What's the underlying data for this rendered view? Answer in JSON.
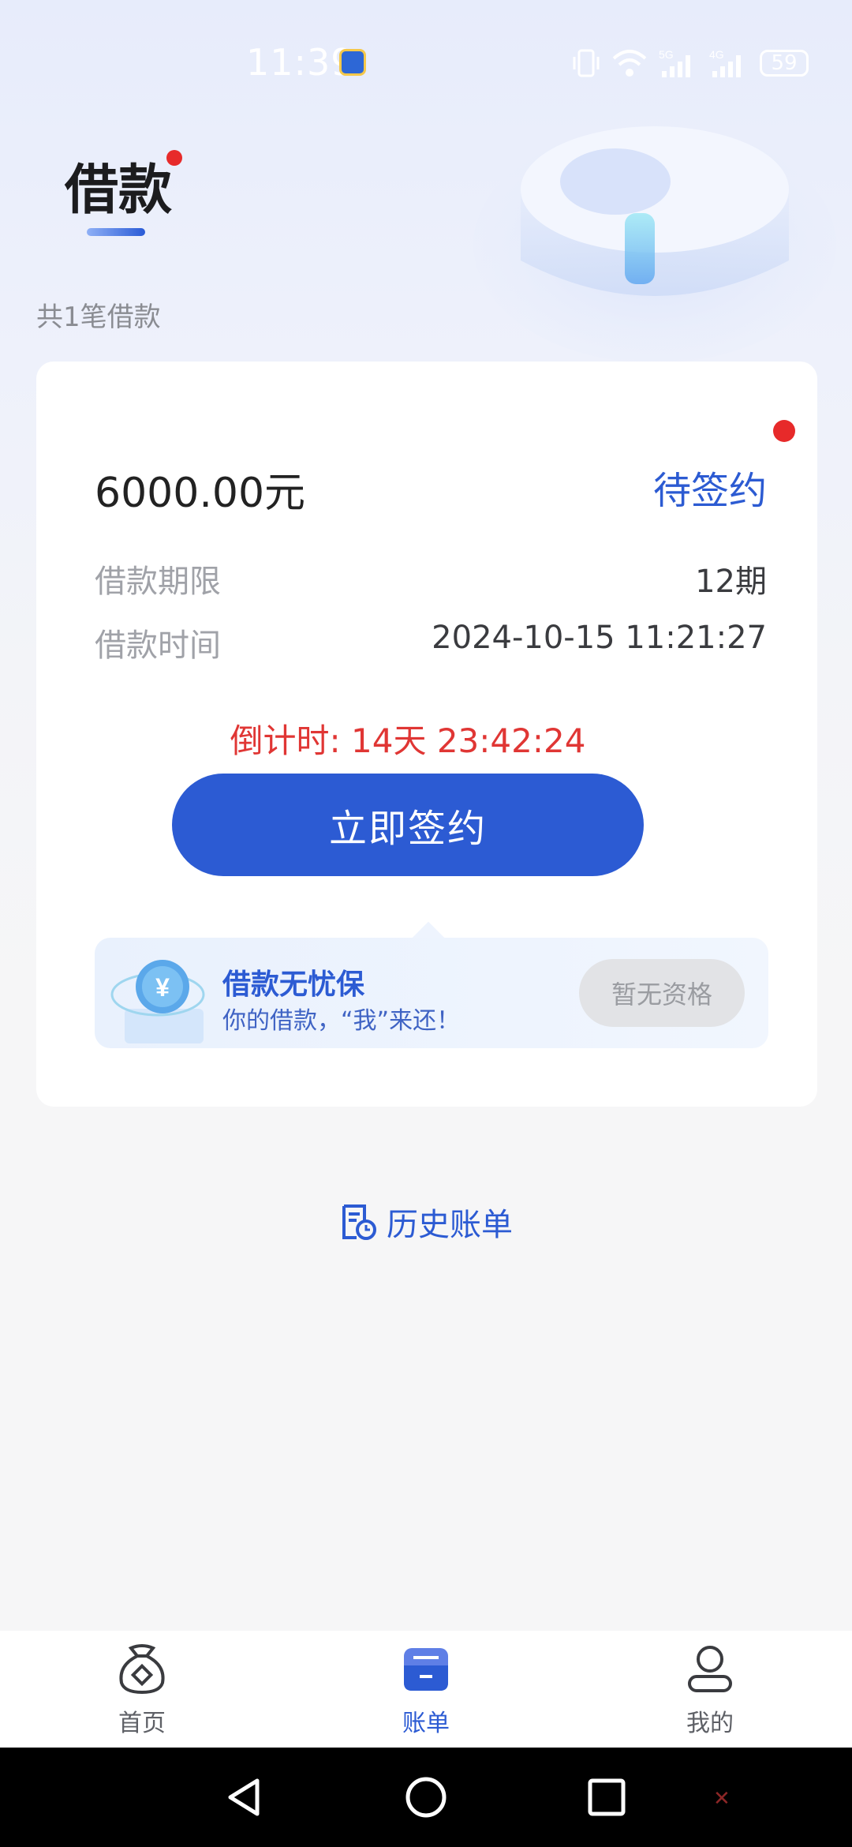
{
  "status_bar": {
    "time": "11:39",
    "battery": "59",
    "network_1": "5G",
    "network_2": "4G"
  },
  "header": {
    "title": "借款",
    "loan_count": "共1笔借款"
  },
  "loan_card": {
    "amount": "6000.00元",
    "status": "待签约",
    "rows": [
      {
        "label": "借款期限",
        "value": "12期"
      },
      {
        "label": "借款时间",
        "value": "2024-10-15 11:21:27"
      }
    ],
    "countdown": "倒计时: 14天 23:42:24",
    "sign_button": "立即签约"
  },
  "insurance": {
    "title": "借款无忧保",
    "subtitle": "你的借款，“我”来还！",
    "button": "暂无资格",
    "icon_symbol": "¥"
  },
  "history": {
    "label": "历史账单"
  },
  "bottom_nav": {
    "items": [
      {
        "label": "首页",
        "icon": "money-bag-icon",
        "active": false
      },
      {
        "label": "账单",
        "icon": "bill-icon",
        "active": true
      },
      {
        "label": "我的",
        "icon": "user-icon",
        "active": false
      }
    ]
  },
  "colors": {
    "accent": "#2c5bd3",
    "alert": "#e03634",
    "background": "#f6f6f7"
  }
}
